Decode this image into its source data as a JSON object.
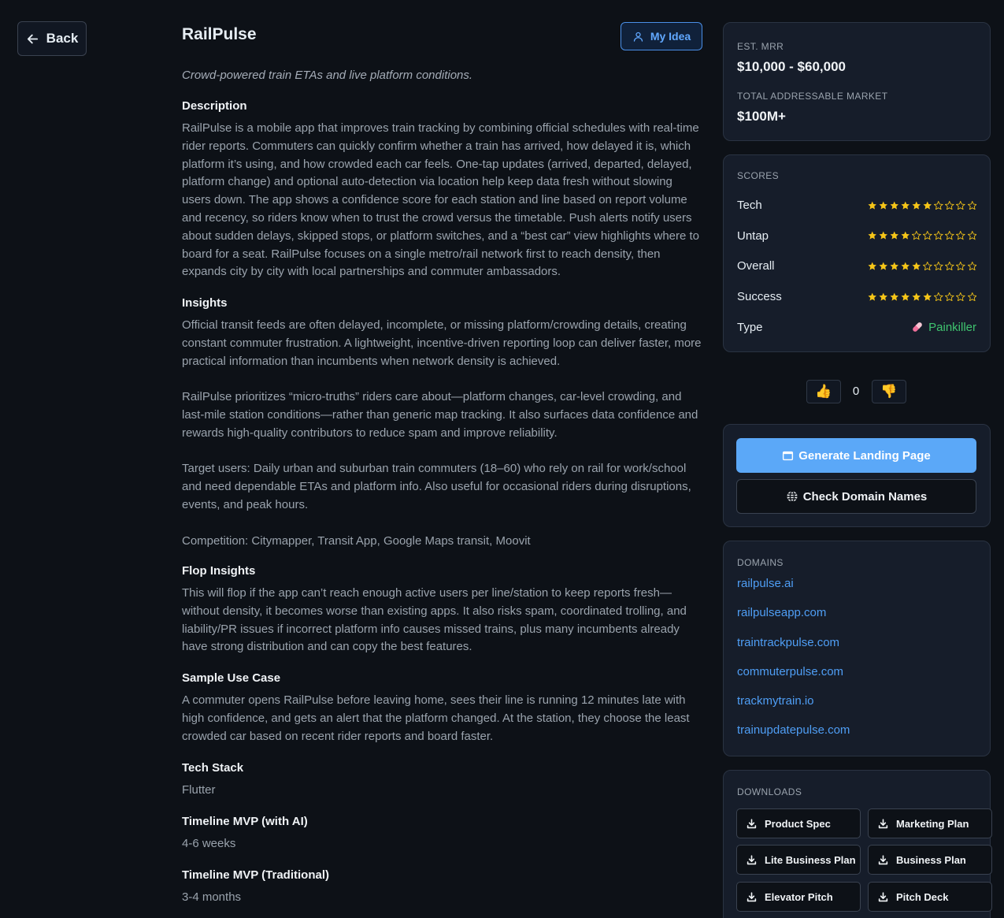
{
  "nav": {
    "back_label": "Back",
    "my_idea_label": "My Idea"
  },
  "idea": {
    "title": "RailPulse",
    "tagline": "Crowd-powered train ETAs and live platform conditions.",
    "sections": [
      {
        "heading": "Description",
        "body": "RailPulse is a mobile app that improves train tracking by combining official schedules with real-time rider reports. Commuters can quickly confirm whether a train has arrived, how delayed it is, which platform it’s using, and how crowded each car feels. One-tap updates (arrived, departed, delayed, platform change) and optional auto-detection via location help keep data fresh without slowing users down. The app shows a confidence score for each station and line based on report volume and recency, so riders know when to trust the crowd versus the timetable. Push alerts notify users about sudden delays, skipped stops, or platform switches, and a “best car” view highlights where to board for a seat. RailPulse focuses on a single metro/rail network first to reach density, then expands city by city with local partnerships and commuter ambassadors."
      },
      {
        "heading": "Insights",
        "body": "Official transit feeds are often delayed, incomplete, or missing platform/crowding details, creating constant commuter frustration. A lightweight, incentive-driven reporting loop can deliver faster, more practical information than incumbents when network density is achieved.\n\nRailPulse prioritizes “micro-truths” riders care about—platform changes, car-level crowding, and last-mile station conditions—rather than generic map tracking. It also surfaces data confidence and rewards high-quality contributors to reduce spam and improve reliability.\n\nTarget users: Daily urban and suburban train commuters (18–60) who rely on rail for work/school and need dependable ETAs and platform info. Also useful for occasional riders during disruptions, events, and peak hours.\n\nCompetition: Citymapper, Transit App, Google Maps transit, Moovit"
      },
      {
        "heading": "Flop Insights",
        "body": "This will flop if the app can’t reach enough active users per line/station to keep reports fresh—without density, it becomes worse than existing apps. It also risks spam, coordinated trolling, and liability/PR issues if incorrect platform info causes missed trains, plus many incumbents already have strong distribution and can copy the best features."
      },
      {
        "heading": "Sample Use Case",
        "body": "A commuter opens RailPulse before leaving home, sees their line is running 12 minutes late with high confidence, and gets an alert that the platform changed. At the station, they choose the least crowded car based on recent rider reports and board faster."
      },
      {
        "heading": "Tech Stack",
        "body": "Flutter"
      },
      {
        "heading": "Timeline MVP (with AI)",
        "body": "4-6 weeks"
      },
      {
        "heading": "Timeline MVP (Traditional)",
        "body": "3-4 months"
      }
    ]
  },
  "market": {
    "mrr_label": "EST. MRR",
    "mrr_value": "$10,000 - $60,000",
    "tam_label": "TOTAL ADDRESSABLE MARKET",
    "tam_value": "$100M+"
  },
  "scores": {
    "heading": "SCORES",
    "max": 10,
    "items": [
      {
        "label": "Tech",
        "value": 6
      },
      {
        "label": "Untap",
        "value": 4
      },
      {
        "label": "Overall",
        "value": 5
      },
      {
        "label": "Success",
        "value": 6
      }
    ],
    "type_label": "Type",
    "type_value": "Painkiller",
    "star_color": "#f5c518",
    "type_color": "#3fc46f"
  },
  "votes": {
    "count": "0",
    "up_icon": "thumbs-up-icon",
    "down_icon": "thumbs-down-icon"
  },
  "actions": {
    "generate_label": "Generate Landing Page",
    "check_domains_label": "Check Domain Names"
  },
  "domains": {
    "heading": "DOMAINS",
    "items": [
      "railpulse.ai",
      "railpulseapp.com",
      "traintrackpulse.com",
      "commuterpulse.com",
      "trackmytrain.io",
      "trainupdatepulse.com"
    ]
  },
  "downloads": {
    "heading": "DOWNLOADS",
    "items": [
      "Product Spec",
      "Marketing Plan",
      "Lite Business Plan",
      "Business Plan",
      "Elevator Pitch",
      "Pitch Deck"
    ]
  }
}
